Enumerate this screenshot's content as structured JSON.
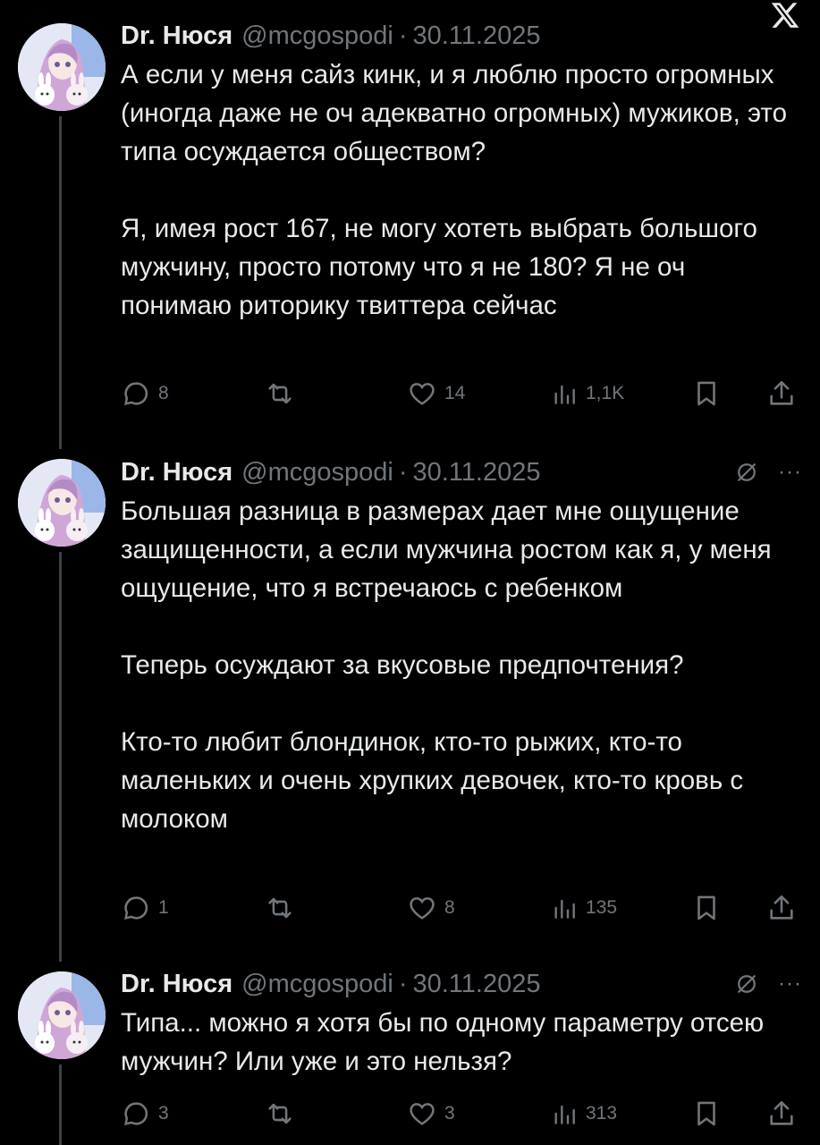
{
  "app": {
    "logo_icon": "x-logo-icon"
  },
  "colors": {
    "background": "#000000",
    "text": "#e7e9ea",
    "secondary": "#71767b",
    "thread_line": "#3e4144"
  },
  "tweets": [
    {
      "author": {
        "name": "Dr. Нюся",
        "handle": "@mcgospodi",
        "date": "30.11.2025"
      },
      "paragraphs": [
        "А если у меня сайз кинк, и я люблю просто огромных (иногда даже не оч адекватно огромных) мужиков, это типа осуждается обществом?",
        "Я, имея рост 167, не могу хотеть выбрать большого мужчину, просто потому что я не 180? Я не оч понимаю риторику твиттера сейчас"
      ],
      "stats": {
        "replies": "8",
        "retweets": "",
        "likes": "14",
        "views": "1,1K"
      }
    },
    {
      "author": {
        "name": "Dr. Нюся",
        "handle": "@mcgospodi",
        "date": "30.11.2025"
      },
      "paragraphs": [
        "Большая разница в размерах дает мне ощущение защищенности, а если мужчина ростом как я, у меня ощущение, что я встречаюсь с ребенком",
        "Теперь осуждают за вкусовые предпочтения?",
        "Кто-то любит блондинок, кто-то рыжих, кто-то маленьких и очень хрупких девочек, кто-то кровь с молоком"
      ],
      "stats": {
        "replies": "1",
        "retweets": "",
        "likes": "8",
        "views": "135"
      }
    },
    {
      "author": {
        "name": "Dr. Нюся",
        "handle": "@mcgospodi",
        "date": "30.11.2025"
      },
      "paragraphs": [
        "Типа... можно я хотя бы по одному параметру отсею мужчин? Или уже и это нельзя?"
      ],
      "stats": {
        "replies": "3",
        "retweets": "",
        "likes": "3",
        "views": "313"
      }
    }
  ]
}
